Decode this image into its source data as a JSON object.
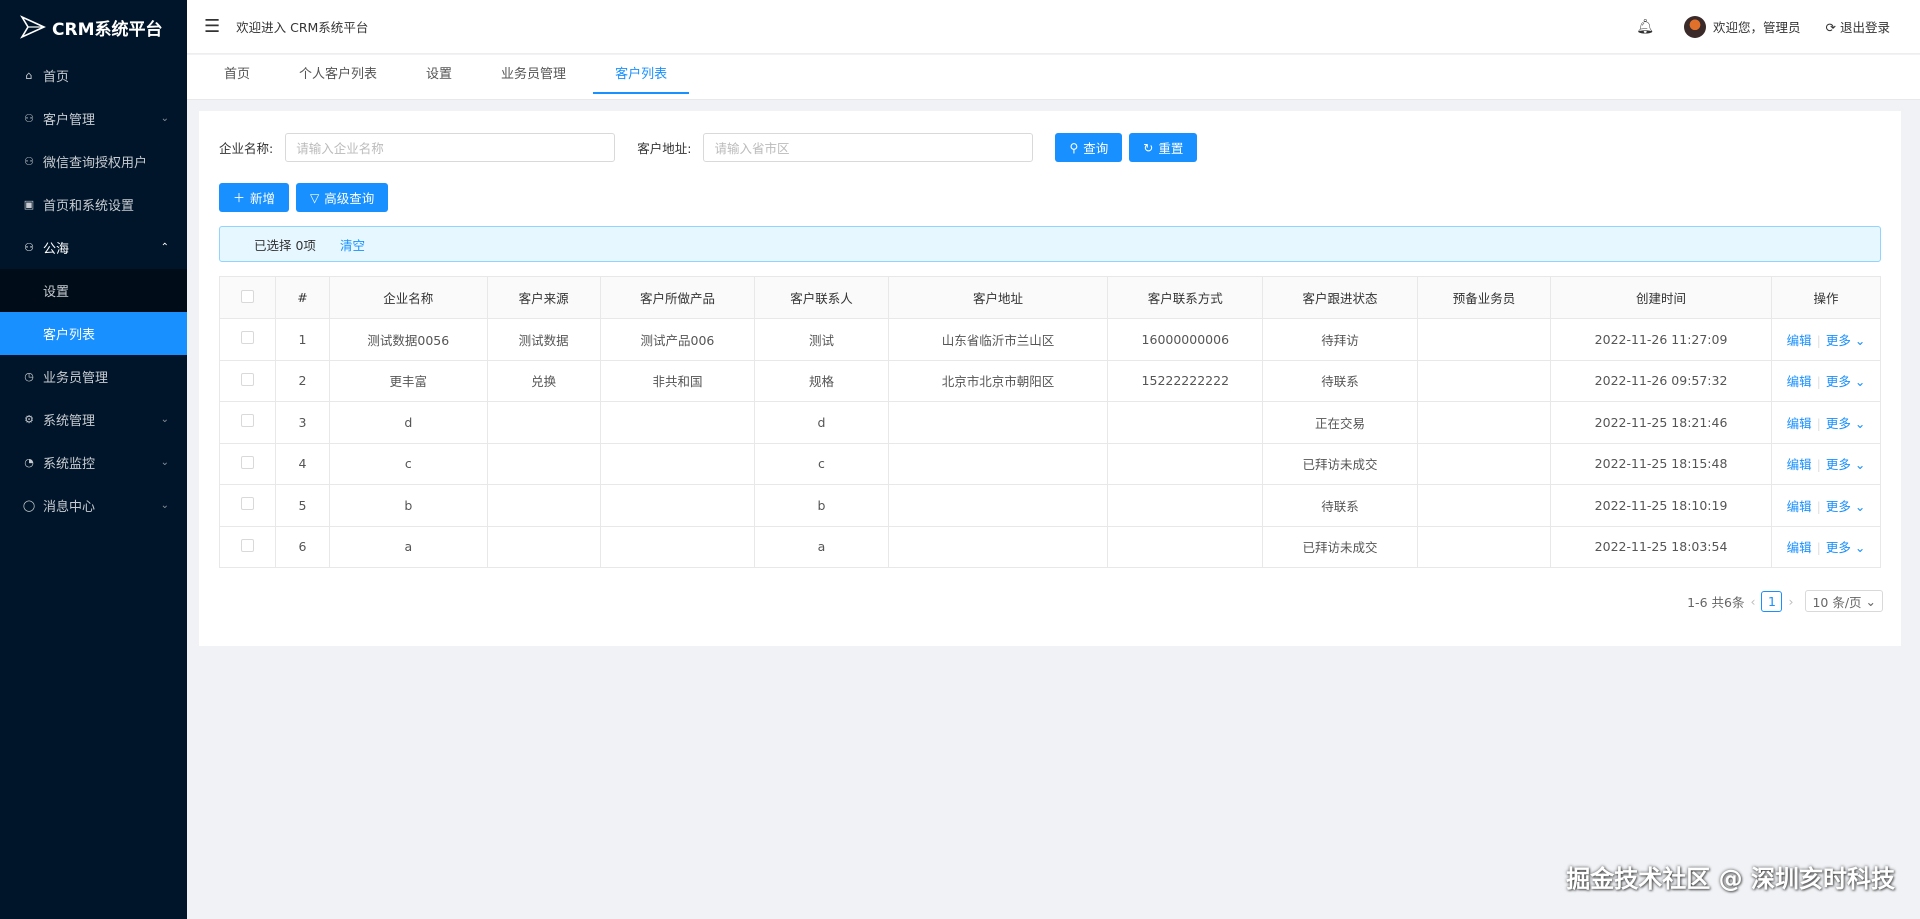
{
  "app": {
    "title": "CRM系统平台"
  },
  "sidebar": {
    "items": [
      {
        "label": "首页",
        "icon": "home-icon"
      },
      {
        "label": "客户管理",
        "icon": "users-icon"
      },
      {
        "label": "微信查询授权用户",
        "icon": "wechat-user-icon"
      },
      {
        "label": "首页和系统设置",
        "icon": "image-icon"
      },
      {
        "label": "公海",
        "icon": "team-icon"
      },
      {
        "label": "设置"
      },
      {
        "label": "客户列表"
      },
      {
        "label": "业务员管理",
        "icon": "clock-icon"
      },
      {
        "label": "系统管理",
        "icon": "gear-icon"
      },
      {
        "label": "系统监控",
        "icon": "monitor-icon"
      },
      {
        "label": "消息中心",
        "icon": "message-icon"
      }
    ]
  },
  "header": {
    "welcome": "欢迎进入 CRM系统平台",
    "user_greeting": "欢迎您，管理员",
    "logout": "退出登录"
  },
  "tabs": [
    "首页",
    "个人客户列表",
    "设置",
    "业务员管理",
    "客户列表"
  ],
  "search": {
    "company_label": "企业名称:",
    "company_placeholder": "请输入企业名称",
    "address_label": "客户地址:",
    "address_placeholder": "请输入省市区",
    "query_label": "查询",
    "reset_label": "重置"
  },
  "toolbar": {
    "add_label": "新增",
    "advanced_label": "高级查询"
  },
  "selection": {
    "selected_text": "已选择 0项",
    "clear_label": "清空"
  },
  "table": {
    "headers": [
      "#",
      "企业名称",
      "客户来源",
      "客户所做产品",
      "客户联系人",
      "客户地址",
      "客户联系方式",
      "客户跟进状态",
      "预备业务员",
      "创建时间",
      "操作"
    ],
    "rows": [
      [
        "1",
        "测试数据0056",
        "测试数据",
        "测试产品006",
        "测试",
        "山东省临沂市兰山区",
        "16000000006",
        "待拜访",
        "",
        "2022-11-26 11:27:09"
      ],
      [
        "2",
        "更丰富",
        "兑换",
        "非共和国",
        "规格",
        "北京市北京市朝阳区",
        "15222222222",
        "待联系",
        "",
        "2022-11-26 09:57:32"
      ],
      [
        "3",
        "d",
        "",
        "",
        "d",
        "",
        "",
        "正在交易",
        "",
        "2022-11-25 18:21:46"
      ],
      [
        "4",
        "c",
        "",
        "",
        "c",
        "",
        "",
        "已拜访未成交",
        "",
        "2022-11-25 18:15:48"
      ],
      [
        "5",
        "b",
        "",
        "",
        "b",
        "",
        "",
        "待联系",
        "",
        "2022-11-25 18:10:19"
      ],
      [
        "6",
        "a",
        "",
        "",
        "a",
        "",
        "",
        "已拜访未成交",
        "",
        "2022-11-25 18:03:54"
      ]
    ],
    "edit_label": "编辑",
    "more_label": "更多"
  },
  "pagination": {
    "summary": "1-6 共6条",
    "current": "1",
    "page_size": "10 条/页"
  },
  "watermark": "掘金技术社区 @ 深圳亥时科技"
}
